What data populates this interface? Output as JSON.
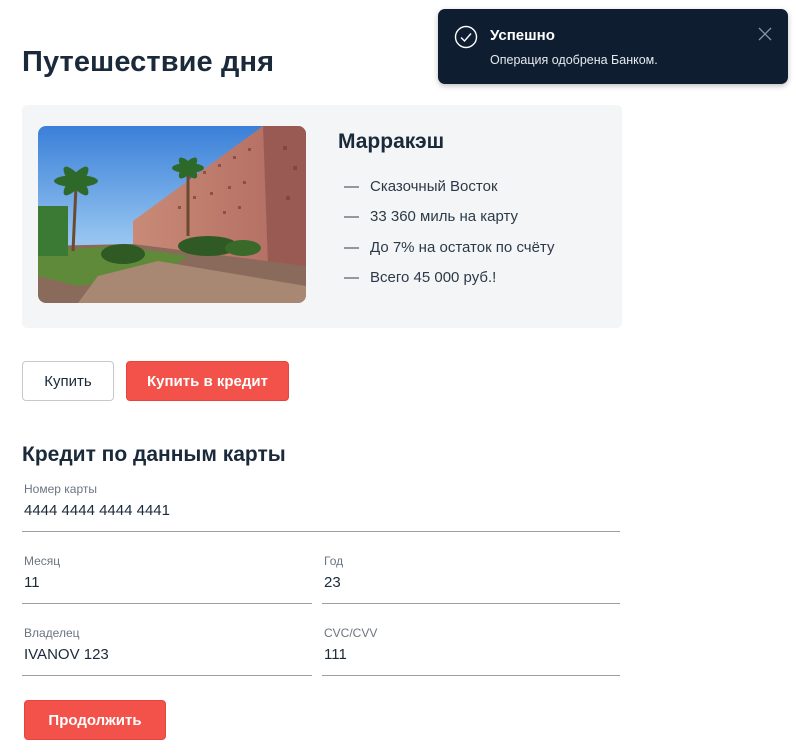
{
  "page": {
    "title": "Путешествие дня"
  },
  "offer": {
    "city": "Марракэш",
    "image_icon": "marrakesh-wall-photo",
    "features": [
      {
        "dash": "—",
        "text": "Сказочный Восток"
      },
      {
        "dash": "—",
        "text": "33 360 миль на карту"
      },
      {
        "dash": "—",
        "text": "До 7% на остаток по счёту"
      },
      {
        "dash": "—",
        "text": "Всего 45 000 руб.!"
      }
    ]
  },
  "actions": {
    "buy": "Купить",
    "buy_credit": "Купить в кредит"
  },
  "credit_form": {
    "title": "Кредит по данным карты",
    "card_number": {
      "label": "Номер карты",
      "value": "4444 4444 4444 4441"
    },
    "month": {
      "label": "Месяц",
      "value": "11"
    },
    "year": {
      "label": "Год",
      "value": "23"
    },
    "owner": {
      "label": "Владелец",
      "value": "IVANOV 123"
    },
    "cvc": {
      "label": "CVC/CVV",
      "value": "111"
    },
    "submit": "Продолжить"
  },
  "notification": {
    "title": "Успешно",
    "message": "Операция одобрена Банком.",
    "icon": "check-circle-icon",
    "close_icon": "close-icon"
  },
  "colors": {
    "accent": "#f2524a",
    "text": "#1b2a3a",
    "card_bg": "#f4f5f7",
    "toast_bg": "#0e1e30"
  }
}
